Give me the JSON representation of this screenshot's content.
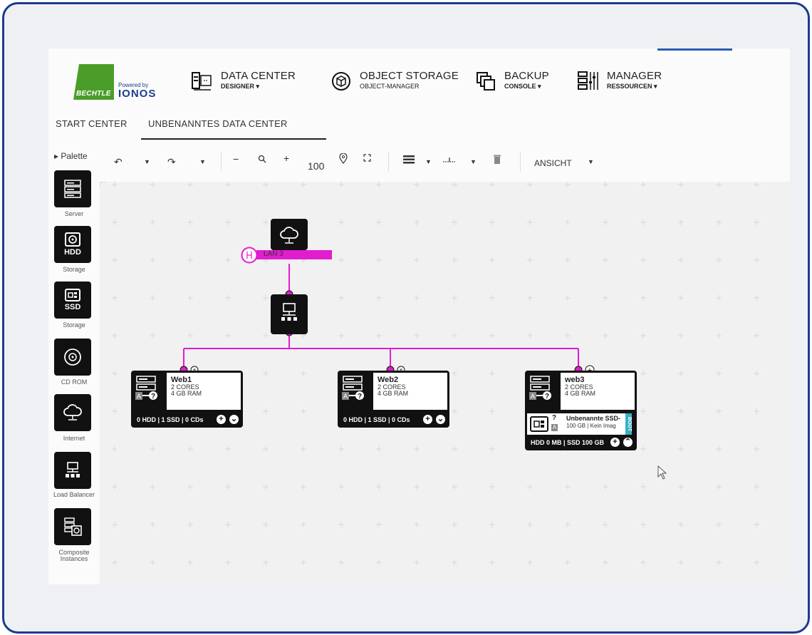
{
  "header": {
    "brand": "BECHTLE",
    "powered_by": "Powered by",
    "partner": "IONOS",
    "products": [
      {
        "title": "DATA CENTER",
        "subtitle": "DESIGNER ▾",
        "icon": "data-center-icon"
      },
      {
        "title": "OBJECT STORAGE",
        "subtitle": "OBJECT-MANAGER",
        "icon": "object-storage-icon"
      },
      {
        "title": "BACKUP",
        "subtitle": "CONSOLE ▾",
        "icon": "backup-icon"
      },
      {
        "title": "MANAGER",
        "subtitle": "RESSOURCEN ▾",
        "icon": "manager-icon"
      }
    ]
  },
  "tabs": [
    {
      "label": "START CENTER",
      "active": false
    },
    {
      "label": "UNBENANNTES DATA CENTER",
      "active": true
    }
  ],
  "toolbar": {
    "zoom": "100",
    "view_label": "ANSICHT"
  },
  "palette": {
    "title": "Palette",
    "items": [
      {
        "label": "Server",
        "icon": "server-icon",
        "badge": ""
      },
      {
        "label": "Storage",
        "icon": "hdd-icon",
        "badge": "HDD"
      },
      {
        "label": "Storage",
        "icon": "ssd-icon",
        "badge": "SSD"
      },
      {
        "label": "CD ROM",
        "icon": "cd-rom-icon",
        "badge": ""
      },
      {
        "label": "Internet",
        "icon": "internet-icon",
        "badge": ""
      },
      {
        "label": "Load Balancer",
        "icon": "load-balancer-icon",
        "badge": ""
      },
      {
        "label": "Composite Instances",
        "icon": "composite-instances-icon",
        "badge": ""
      }
    ]
  },
  "canvas": {
    "lan_label": "LAN 3",
    "servers": [
      {
        "name": "Web1",
        "cores": "2 CORES",
        "ram": "4 GB RAM",
        "footer": "0 HDD | 1 SSD | 0 CDs",
        "expanded": false
      },
      {
        "name": "Web2",
        "cores": "2 CORES",
        "ram": "4 GB RAM",
        "footer": "0 HDD | 1 SSD | 0 CDs",
        "expanded": false
      },
      {
        "name": "web3",
        "cores": "2 CORES",
        "ram": "4 GB RAM",
        "footer": "HDD 0 MB | SSD 100 GB",
        "expanded": true,
        "disk": {
          "mark": "?",
          "type_badge": "A",
          "name": "Unbenannte SSD-",
          "detail": "100 GB | Kein Imag",
          "boot": "BOOT"
        }
      }
    ]
  },
  "colors": {
    "accent": "#e21ccf",
    "brand_green": "#4b9d2a",
    "brand_blue": "#1a3d8f",
    "frame": "#1a3c8f",
    "boot": "#3ab0c8"
  }
}
